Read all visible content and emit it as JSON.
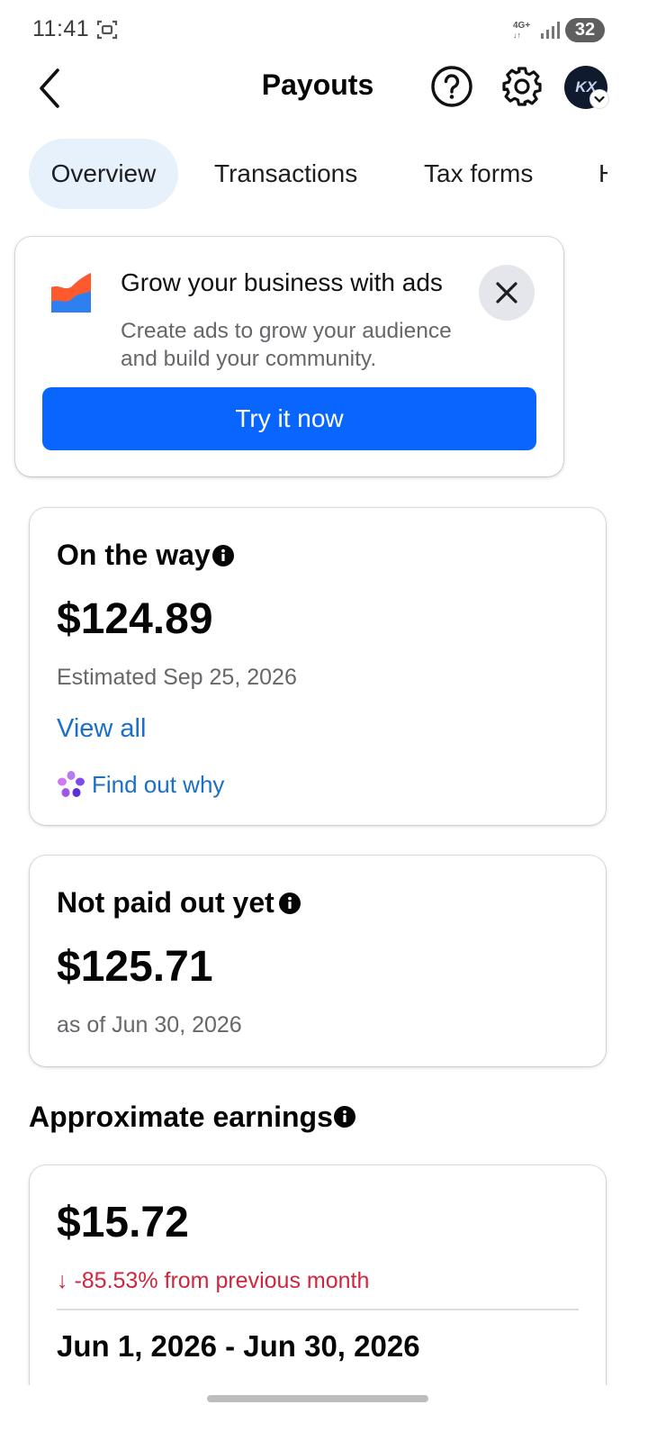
{
  "status_bar": {
    "time": "11:41",
    "network_top": "4G+",
    "battery": "32",
    "icons": [
      "screenshot-icon",
      "signal-icon"
    ]
  },
  "header": {
    "title": "Payouts",
    "icons": [
      "back-arrow-icon",
      "help-icon",
      "gear-icon"
    ],
    "avatar_initials": "KX"
  },
  "tabs": [
    {
      "label": "Overview",
      "active": true
    },
    {
      "label": "Transactions",
      "active": false
    },
    {
      "label": "Tax forms",
      "active": false
    },
    {
      "label": "H",
      "active": false
    }
  ],
  "ad_card": {
    "title": "Grow your business with ads",
    "body": "Create ads to grow your audience and build your community.",
    "cta": "Try it now"
  },
  "on_the_way": {
    "heading": "On the way",
    "amount": "$124.89",
    "estimate": "Estimated Sep 25, 2026",
    "view_all": "View all",
    "find_out": "Find out why"
  },
  "not_paid": {
    "heading": "Not paid out yet",
    "amount": "$125.71",
    "as_of": "as of Jun 30, 2026"
  },
  "approximate": {
    "heading": "Approximate earnings",
    "amount": "$15.72",
    "change": "↓ -85.53% from previous month",
    "range": "Jun 1, 2026 - Jun 30, 2026"
  },
  "colors": {
    "accent": "#0866ff",
    "link": "#1a6fc7",
    "negative": "#d0263d",
    "tab_active_bg": "#e7f1fc"
  }
}
